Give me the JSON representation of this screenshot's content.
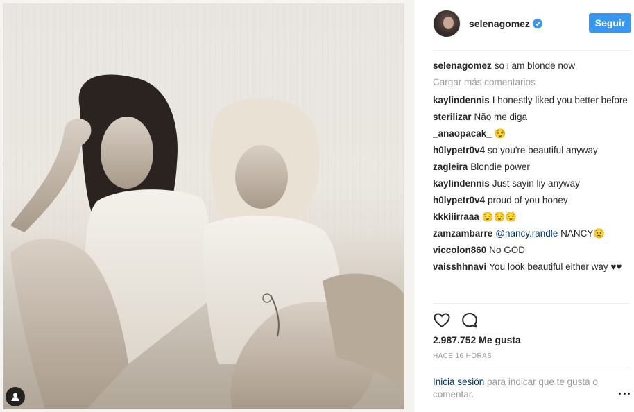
{
  "post": {
    "username": "selenagomez",
    "follow_label": "Seguir",
    "caption": "so i am blonde now",
    "load_more": "Cargar más comentarios",
    "likes": "2.987.752 Me gusta",
    "time": "HACE 16 HORAS",
    "login_link": "Inicia sesión",
    "login_text": " para indicar que te gusta o comentar."
  },
  "comments": [
    {
      "author": "kaylindennis",
      "text": "I honestly liked you better before"
    },
    {
      "author": "sterilizar",
      "text": "Não me diga"
    },
    {
      "author": "_anaopacak_",
      "text": "😌"
    },
    {
      "author": "h0lypetr0v4",
      "text": "so you're beautiful anyway"
    },
    {
      "author": "zagleira",
      "text": "Blondie power"
    },
    {
      "author": "kaylindennis",
      "text": "Just sayin liy anyway"
    },
    {
      "author": "h0lypetr0v4",
      "text": "proud of you honey"
    },
    {
      "author": "kkkiiirraaa",
      "text": "😌😌😌"
    },
    {
      "author": "zamzambarre",
      "mention": "@nancy.randle",
      "text": " NANCY😟"
    },
    {
      "author": "viccolon860",
      "text": "No GOD"
    },
    {
      "author": "vaisshhnavi",
      "text": "You look beautiful either way ♥♥"
    }
  ],
  "icons": {
    "like": "heart-icon",
    "comment": "comment-icon",
    "verified": "verified-badge-icon",
    "user_tag": "user-tag-icon",
    "more": "more-options-icon"
  },
  "colors": {
    "accent": "#3897f0",
    "link": "#003569",
    "muted": "#999999",
    "text": "#262626"
  }
}
